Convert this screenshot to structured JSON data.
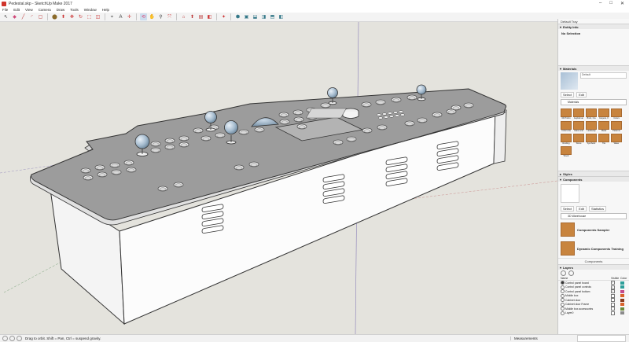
{
  "window": {
    "title": "Pedestal.skp - SketchUp Make 2017",
    "controls": [
      "–",
      "□",
      "✕"
    ]
  },
  "menu": [
    "File",
    "Edit",
    "View",
    "Camera",
    "Draw",
    "Tools",
    "Window",
    "Help"
  ],
  "toolbar_icons": [
    "select-icon",
    "eraser-icon",
    "line-icon",
    "arc-icon",
    "shapes-icon",
    "paint-bucket-icon",
    "push-pull-icon",
    "move-icon",
    "rotate-icon",
    "scale-icon",
    "offset-icon",
    "tape-measure-icon",
    "text-icon",
    "axes-icon",
    "orbit-icon",
    "pan-icon",
    "zoom-icon",
    "zoom-extents-icon",
    "warehouse-icon",
    "share-model-icon",
    "extension-warehouse-icon",
    "layout-icon",
    "extension-manager-icon",
    "iso-view-icon",
    "top-view-icon",
    "front-view-icon",
    "right-view-icon",
    "back-view-icon",
    "left-view-icon"
  ],
  "status": {
    "hint": "Drag to orbit. Shift = Pan, Ctrl = suspend gravity.",
    "measurements_label": "Measurements"
  },
  "tray": {
    "title": "Default Tray",
    "entity_info": {
      "label": "Entity Info",
      "selection": "No Selection"
    },
    "materials": {
      "label": "Materials",
      "current_name": "Default",
      "tabs": [
        "Select",
        "Edit"
      ],
      "collection": "Materials",
      "items": [
        "3D Printin",
        "Asphalt an",
        "Brick, Cla",
        "Carpets, F",
        "Colors",
        "Colors-Na",
        "Glass and",
        "Landscap",
        "Metal",
        "Patterns",
        "Roofing",
        "Stone",
        "Synthetic",
        "Tile",
        "Water",
        "Wood"
      ]
    },
    "styles": {
      "label": "Styles"
    },
    "components": {
      "label": "Components",
      "tabs": [
        "Select",
        "Edit",
        "Statistics"
      ],
      "search_placeholder": "3D Warehouse",
      "items": [
        {
          "title": "Components Sampler",
          "sub": ""
        },
        {
          "title": "Dynamic Components Training",
          "sub": ""
        }
      ],
      "footer": "Components"
    },
    "layers": {
      "label": "Layers",
      "col_name": "Name",
      "col_visible": "Visible",
      "col_color": "Color",
      "rows": [
        {
          "name": "Control panel board",
          "visible": true,
          "color": "#2e9f9a",
          "active": true
        },
        {
          "name": "Control panel controls",
          "visible": true,
          "color": "#2e9f9a",
          "active": false
        },
        {
          "name": "Control panel bottom",
          "visible": true,
          "color": "#c44a8a",
          "active": false
        },
        {
          "name": "Middle box",
          "visible": false,
          "color": "#d9622b",
          "active": false
        },
        {
          "name": "Cabinet door",
          "visible": false,
          "color": "#8a3b1e",
          "active": false
        },
        {
          "name": "Cabinet door Frame",
          "visible": false,
          "color": "#d9622b",
          "active": false
        },
        {
          "name": "Middle box accessories",
          "visible": false,
          "color": "#6b8a3a",
          "active": false
        },
        {
          "name": "Layer0",
          "visible": false,
          "color": "#8b8b8b",
          "active": false
        }
      ]
    }
  }
}
